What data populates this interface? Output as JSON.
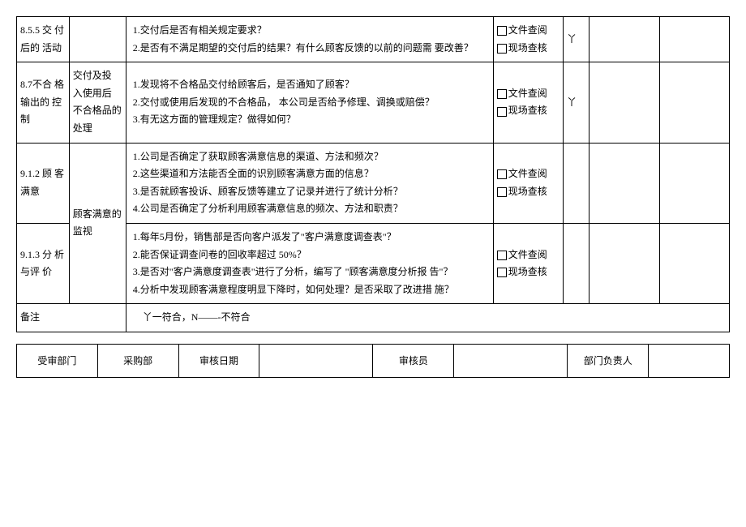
{
  "rows": [
    {
      "id": "8.5.5 交 付后的 活动",
      "topic": "",
      "questions": "1.交付后是否有相关规定要求？\n2.是否有不满足期望的交付后的结果？有什么顾客反馈的以前的问题需 要改善？",
      "chk1": "文件查阅",
      "chk2": "现场查核",
      "result": "丫"
    },
    {
      "id": "8.7不合 格输出的 控制",
      "topic": "交付及投 入使用后 不合格品的 处理",
      "questions": "1.发现将不合格品交付给顾客后，是否通知了顾客？\n2.交付或使用后发现的不合格品，  本公司是否给予修理、调换或赔偿？\n3.有无这方面的管理规定？做得如何？",
      "chk1": "文件查阅",
      "chk2": "现场查核",
      "result": "丫"
    },
    {
      "id": "9.1.2 顾 客满意",
      "topic": "顾客满意的 监视",
      "questions": "1.公司是否确定了获取顾客满意信息的渠道、方法和频次？\n2.这些渠道和方法能否全面的识别顾客满意方面的信息？\n3.是否就顾客投诉、顾客反馈等建立了记录并进行了统计分析？\n4.公司是否确定了分析利用顾客满意信息的频次、方法和职责？",
      "chk1": "文件查阅",
      "chk2": "现场查核",
      "result": ""
    },
    {
      "id": "9.1.3 分 析与评 价",
      "topic": "",
      "questions": "1.每年5月份，销售部是否向客户派发了\"客户满意度调查表\"？\n2.能否保证调查问卷的回收率超过    50%？\n3.是否对\"客户满意度调查表\"进行了分析，编写了 \"顾客满意度分析报 告\"？\n4.分析中发现顾客满意程度明显下降时，如何处理？是否采取了改进措 施？",
      "chk1": "文件查阅",
      "chk2": "现场查核",
      "result": ""
    }
  ],
  "remark": {
    "label": "备注",
    "text": "丫一符合，N——-不符合"
  },
  "footer": {
    "dept_label": "受审部门",
    "dept_value": "采购部",
    "date_label": "审核日期",
    "date_value": "",
    "auditor_label": "审核员",
    "auditor_value": "",
    "owner_label": "部门负责人",
    "owner_value": ""
  }
}
